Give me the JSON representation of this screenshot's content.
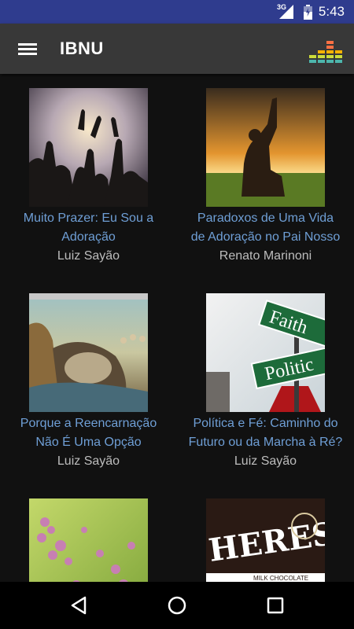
{
  "status": {
    "time": "5:43",
    "network": "3G"
  },
  "app": {
    "title": "IBNU"
  },
  "items": [
    {
      "title_line1": "Muito Prazer: Eu Sou a",
      "title_line2": "Adoração",
      "author": "Luiz Sayão",
      "image": "worship-hands-image"
    },
    {
      "title_line1": "Paradoxos de Uma Vida",
      "title_line2": "de Adoração no Pai Nosso",
      "author": "Renato Marinoni",
      "image": "kneeling-sunset-image"
    },
    {
      "title_line1": "Porque a Reencarnação",
      "title_line2": "Não É Uma Opção",
      "author": "Luiz Sayão",
      "image": "reincarnation-painting-image"
    },
    {
      "title_line1": "Política e Fé: Caminho do",
      "title_line2": "Futuro ou da Marcha à Ré?",
      "author": "Luiz Sayão",
      "image": "faith-politics-sign-image",
      "sign_top": "Faith",
      "sign_bottom": "Politic"
    },
    {
      "title_line1": "",
      "title_line2": "",
      "author": "",
      "image": "pink-flowers-image"
    },
    {
      "title_line1": "",
      "title_line2": "",
      "author": "",
      "image": "heresy-chocolate-image",
      "wrapper_text": "HERESY",
      "wrapper_small": "MILK CHOCOLATE"
    }
  ],
  "colors": {
    "status_bar": "#2f3c8e",
    "app_bar": "#383838",
    "background": "#111111",
    "title_link": "#6f9fd6",
    "author_text": "#bdbdbd"
  }
}
